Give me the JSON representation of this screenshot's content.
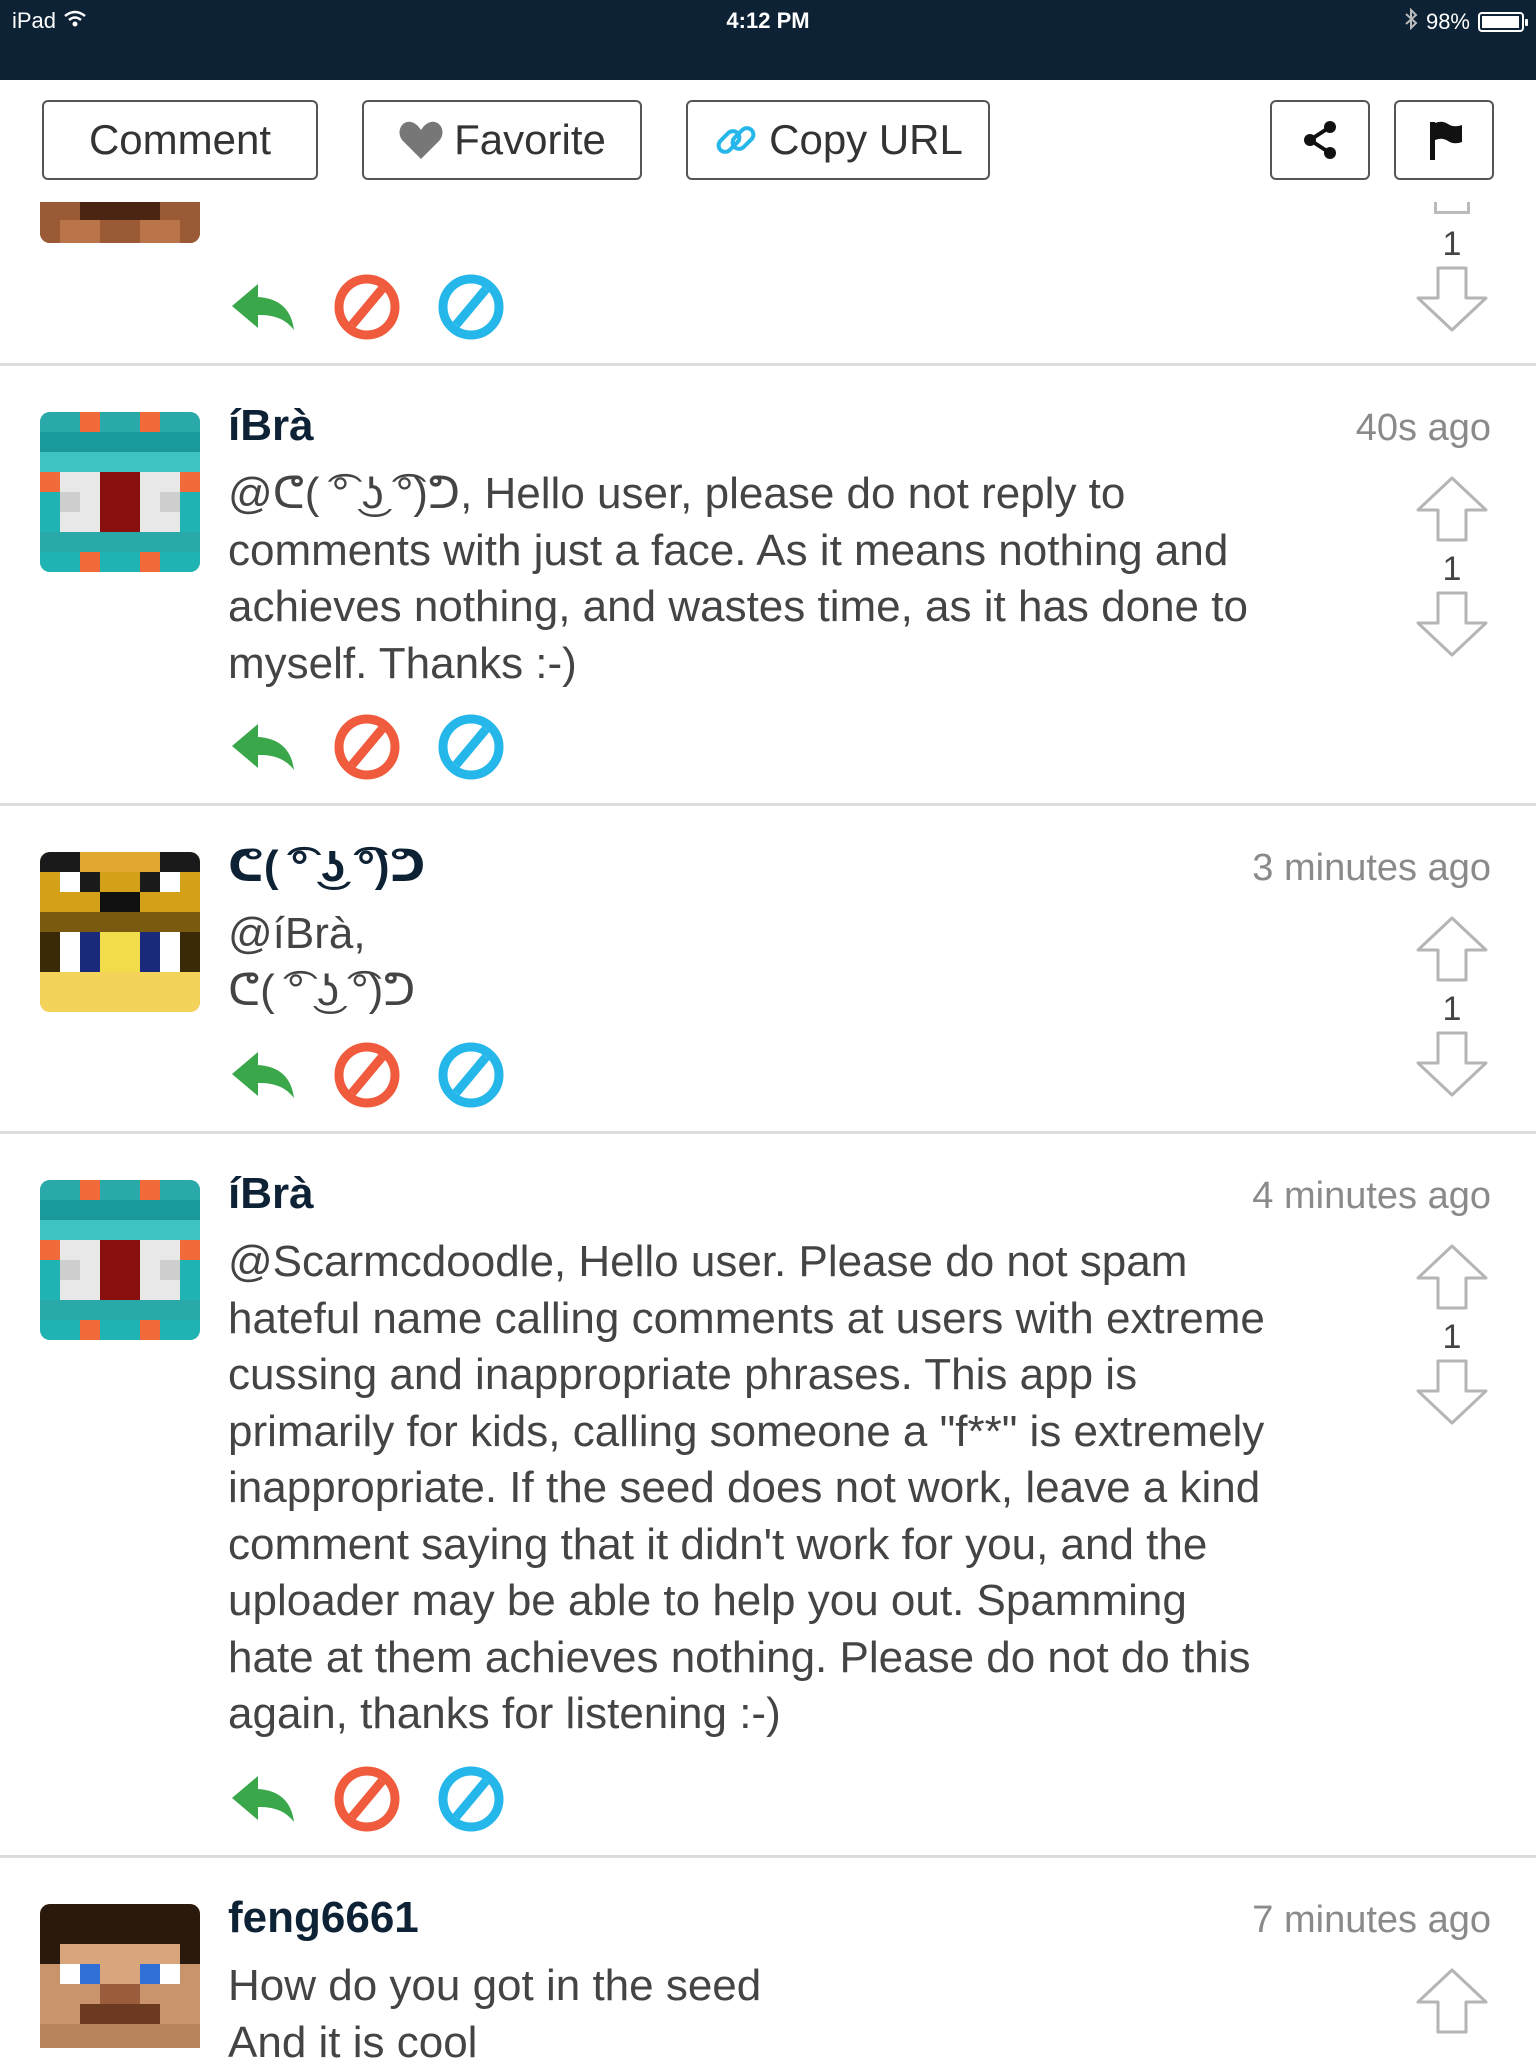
{
  "status_bar": {
    "device": "iPad",
    "time": "4:12 PM",
    "battery": "98%",
    "battery_level": 0.98
  },
  "toolbar": {
    "comment_label": "Comment",
    "favorite_label": "Favorite",
    "copy_url_label": "Copy URL"
  },
  "colors": {
    "header_bg": "#0e2235",
    "reply_green": "#3aa84a",
    "block_red": "#ef5b3c",
    "hide_blue": "#25b7ea"
  },
  "partial_comment": {
    "votes": "1"
  },
  "comments": [
    {
      "username": "íBrà",
      "time": "40s ago",
      "lines": [
        "@ᕦ( ͡° ͜ʖ ͡°)ᕤ, Hello user, please do not reply to",
        "comments with just a face. As it means nothing and",
        "achieves nothing, and wastes time, as it has done to",
        "myself. Thanks :-)"
      ],
      "votes": "1"
    },
    {
      "username": "ᕦ( ͡° ͜ʖ ͡°)ᕤ",
      "time": "3 minutes ago",
      "lines": [
        "@íBrà,",
        "ᕦ( ͡° ͜ʖ ͡°)ᕤ"
      ],
      "votes": "1"
    },
    {
      "username": "íBrà",
      "time": "4 minutes ago",
      "lines": [
        "@Scarmcdoodle, Hello user. Please do not spam",
        "hateful name calling comments at users with extreme",
        "cussing and inappropriate phrases. This app is",
        "primarily for kids, calling someone a \"f**\" is extremely",
        "inappropriate. If the seed does not work, leave a kind",
        "comment saying that it didn't work for you, and the",
        "uploader may be able to help you out. Spamming",
        "hate at them achieves nothing. Please do not do this",
        "again, thanks for listening :-)"
      ],
      "votes": "1"
    },
    {
      "username": "feng6661",
      "time": "7 minutes ago",
      "lines": [
        "How do you got in the seed",
        "And it is cool"
      ]
    }
  ]
}
